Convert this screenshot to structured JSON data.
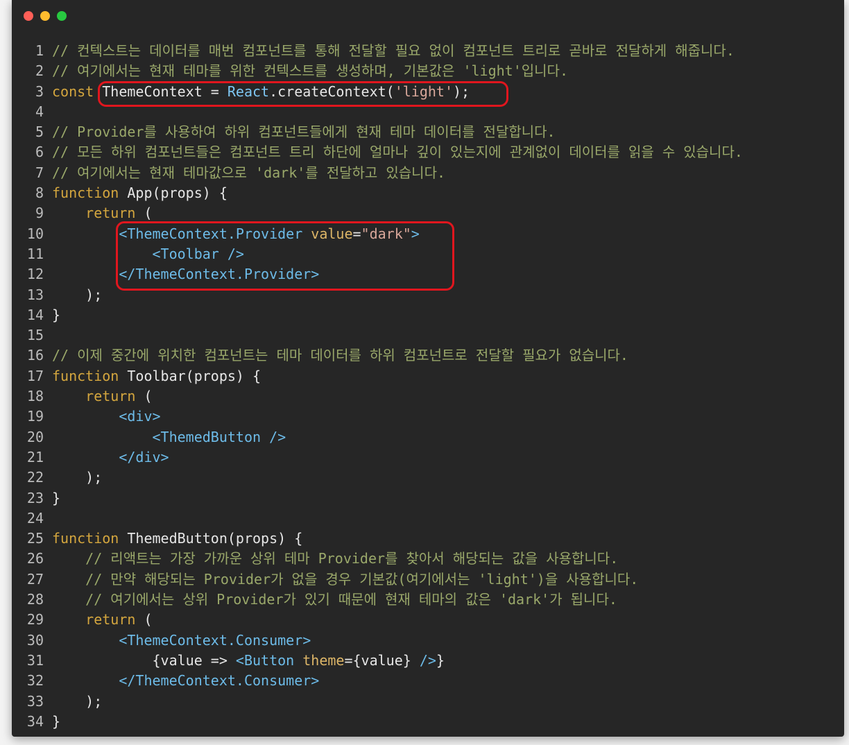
{
  "window": {
    "controls": [
      {
        "name": "close",
        "color": "#ff5f57"
      },
      {
        "name": "minimize",
        "color": "#febc2e"
      },
      {
        "name": "zoom",
        "color": "#28c840"
      }
    ]
  },
  "colors": {
    "comment": "#9aa86a",
    "keyword": "#d4a63e",
    "string": "#d8a79a",
    "tag": "#6dbbe8",
    "attr": "#dcb567",
    "highlight": "#e0161e"
  },
  "code": {
    "lines": [
      {
        "no": "1",
        "tokens": [
          {
            "t": "comment",
            "v": "// 컨텍스트는 데이터를 매번 컴포넌트를 통해 전달할 필요 없이 컴포넌트 트리로 곧바로 전달하게 해줍니다."
          }
        ]
      },
      {
        "no": "2",
        "tokens": [
          {
            "t": "comment",
            "v": "// 여기에서는 현재 테마를 위한 컨텍스트를 생성하며, 기본값은 'light'입니다."
          }
        ]
      },
      {
        "no": "3",
        "tokens": [
          {
            "t": "keyword",
            "v": "const "
          },
          {
            "t": "ident",
            "v": "ThemeContext"
          },
          {
            "t": "plain",
            "v": " = "
          },
          {
            "t": "react",
            "v": "React"
          },
          {
            "t": "plain",
            "v": ".createContext("
          },
          {
            "t": "string",
            "v": "'light'"
          },
          {
            "t": "plain",
            "v": ");"
          }
        ]
      },
      {
        "no": "4",
        "tokens": []
      },
      {
        "no": "5",
        "tokens": [
          {
            "t": "comment",
            "v": "// Provider를 사용하여 하위 컴포넌트들에게 현재 테마 데이터를 전달합니다."
          }
        ]
      },
      {
        "no": "6",
        "tokens": [
          {
            "t": "comment",
            "v": "// 모든 하위 컴포넌트들은 컴포넌트 트리 하단에 얼마나 깊이 있는지에 관계없이 데이터를 읽을 수 있습니다."
          }
        ]
      },
      {
        "no": "7",
        "tokens": [
          {
            "t": "comment",
            "v": "// 여기에서는 현재 테마값으로 'dark'를 전달하고 있습니다."
          }
        ]
      },
      {
        "no": "8",
        "tokens": [
          {
            "t": "keyword",
            "v": "function "
          },
          {
            "t": "ident",
            "v": "App"
          },
          {
            "t": "plain",
            "v": "(props) {"
          }
        ]
      },
      {
        "no": "9",
        "tokens": [
          {
            "t": "plain",
            "v": "    "
          },
          {
            "t": "keyword",
            "v": "return"
          },
          {
            "t": "plain",
            "v": " ("
          }
        ]
      },
      {
        "no": "10",
        "tokens": [
          {
            "t": "plain",
            "v": "        "
          },
          {
            "t": "tag",
            "v": "<ThemeContext.Provider "
          },
          {
            "t": "attr",
            "v": "value"
          },
          {
            "t": "plain",
            "v": "="
          },
          {
            "t": "string",
            "v": "\"dark\""
          },
          {
            "t": "tag",
            "v": ">"
          }
        ]
      },
      {
        "no": "11",
        "tokens": [
          {
            "t": "plain",
            "v": "            "
          },
          {
            "t": "tag",
            "v": "<Toolbar />"
          }
        ]
      },
      {
        "no": "12",
        "tokens": [
          {
            "t": "plain",
            "v": "        "
          },
          {
            "t": "tag",
            "v": "</ThemeContext.Provider>"
          }
        ]
      },
      {
        "no": "13",
        "tokens": [
          {
            "t": "plain",
            "v": "    );"
          }
        ]
      },
      {
        "no": "14",
        "tokens": [
          {
            "t": "plain",
            "v": "}"
          }
        ]
      },
      {
        "no": "15",
        "tokens": []
      },
      {
        "no": "16",
        "tokens": [
          {
            "t": "comment",
            "v": "// 이제 중간에 위치한 컴포넌트는 테마 데이터를 하위 컴포넌트로 전달할 필요가 없습니다."
          }
        ]
      },
      {
        "no": "17",
        "tokens": [
          {
            "t": "keyword",
            "v": "function "
          },
          {
            "t": "ident",
            "v": "Toolbar"
          },
          {
            "t": "plain",
            "v": "(props) {"
          }
        ]
      },
      {
        "no": "18",
        "tokens": [
          {
            "t": "plain",
            "v": "    "
          },
          {
            "t": "keyword",
            "v": "return"
          },
          {
            "t": "plain",
            "v": " ("
          }
        ]
      },
      {
        "no": "19",
        "tokens": [
          {
            "t": "plain",
            "v": "        "
          },
          {
            "t": "tag",
            "v": "<div>"
          }
        ]
      },
      {
        "no": "20",
        "tokens": [
          {
            "t": "plain",
            "v": "            "
          },
          {
            "t": "tag",
            "v": "<ThemedButton />"
          }
        ]
      },
      {
        "no": "21",
        "tokens": [
          {
            "t": "plain",
            "v": "        "
          },
          {
            "t": "tag",
            "v": "</div>"
          }
        ]
      },
      {
        "no": "22",
        "tokens": [
          {
            "t": "plain",
            "v": "    );"
          }
        ]
      },
      {
        "no": "23",
        "tokens": [
          {
            "t": "plain",
            "v": "}"
          }
        ]
      },
      {
        "no": "24",
        "tokens": []
      },
      {
        "no": "25",
        "tokens": [
          {
            "t": "keyword",
            "v": "function "
          },
          {
            "t": "ident",
            "v": "ThemedButton"
          },
          {
            "t": "plain",
            "v": "(props) {"
          }
        ]
      },
      {
        "no": "26",
        "tokens": [
          {
            "t": "plain",
            "v": "    "
          },
          {
            "t": "comment",
            "v": "// 리액트는 가장 가까운 상위 테마 Provider를 찾아서 해당되는 값을 사용합니다."
          }
        ]
      },
      {
        "no": "27",
        "tokens": [
          {
            "t": "plain",
            "v": "    "
          },
          {
            "t": "comment",
            "v": "// 만약 해당되는 Provider가 없을 경우 기본값(여기에서는 'light')을 사용합니다."
          }
        ]
      },
      {
        "no": "28",
        "tokens": [
          {
            "t": "plain",
            "v": "    "
          },
          {
            "t": "comment",
            "v": "// 여기에서는 상위 Provider가 있기 때문에 현재 테마의 값은 'dark'가 됩니다."
          }
        ]
      },
      {
        "no": "29",
        "tokens": [
          {
            "t": "plain",
            "v": "    "
          },
          {
            "t": "keyword",
            "v": "return"
          },
          {
            "t": "plain",
            "v": " ("
          }
        ]
      },
      {
        "no": "30",
        "tokens": [
          {
            "t": "plain",
            "v": "        "
          },
          {
            "t": "tag",
            "v": "<ThemeContext.Consumer>"
          }
        ]
      },
      {
        "no": "31",
        "tokens": [
          {
            "t": "plain",
            "v": "            {value => "
          },
          {
            "t": "tag",
            "v": "<Button "
          },
          {
            "t": "attr",
            "v": "theme"
          },
          {
            "t": "plain",
            "v": "={value} "
          },
          {
            "t": "tag",
            "v": "/>"
          },
          {
            "t": "plain",
            "v": "}"
          }
        ]
      },
      {
        "no": "32",
        "tokens": [
          {
            "t": "plain",
            "v": "        "
          },
          {
            "t": "tag",
            "v": "</ThemeContext.Consumer>"
          }
        ]
      },
      {
        "no": "33",
        "tokens": [
          {
            "t": "plain",
            "v": "    );"
          }
        ]
      },
      {
        "no": "34",
        "tokens": [
          {
            "t": "plain",
            "v": "}"
          }
        ]
      }
    ]
  },
  "highlights": [
    {
      "name": "create-context-highlight"
    },
    {
      "name": "provider-block-highlight"
    }
  ]
}
